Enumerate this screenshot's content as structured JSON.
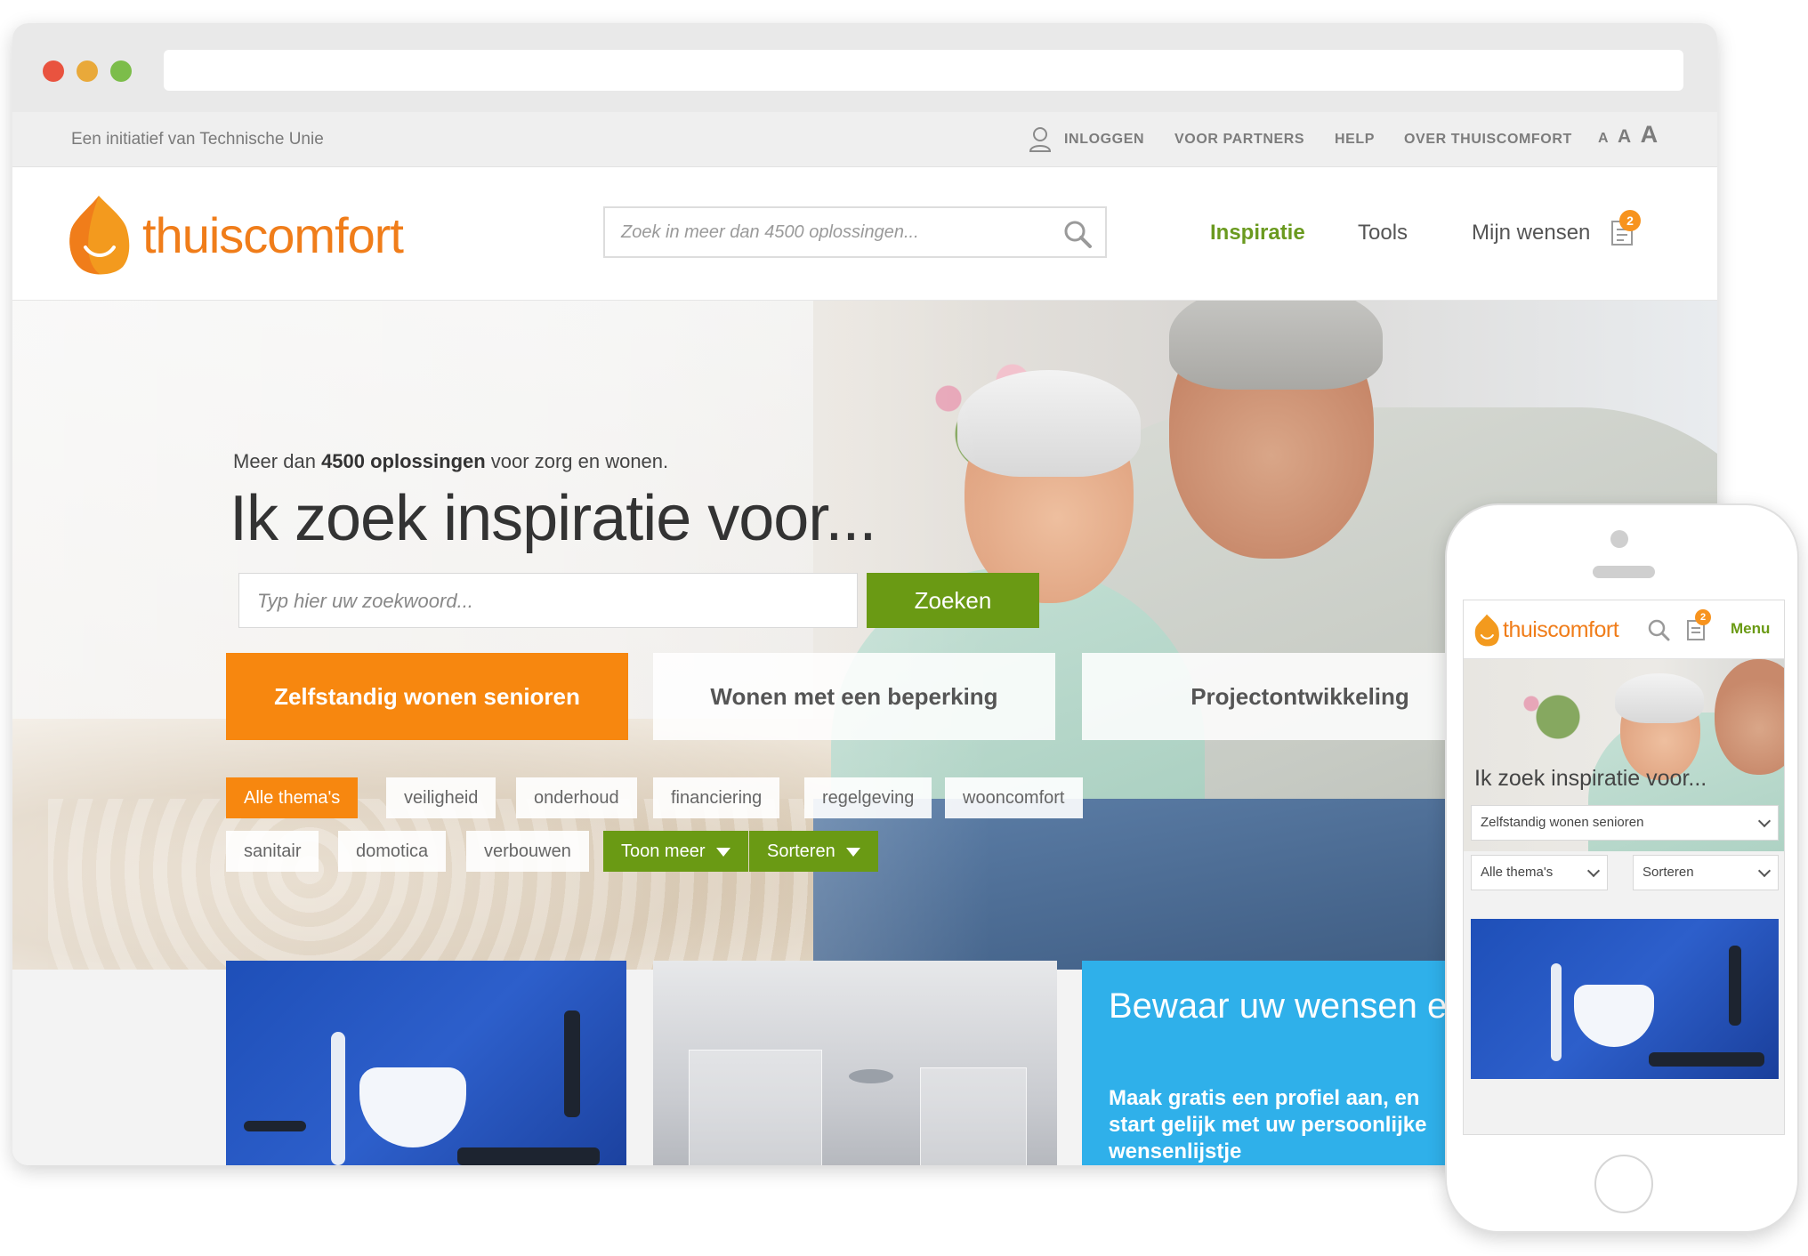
{
  "colors": {
    "brand_orange": "#f07d1a",
    "cta_green": "#6a9a14",
    "accent_orange": "#f7870f",
    "info_blue": "#2fb0ea"
  },
  "desktop": {
    "topbar": {
      "initiative": "Een initiatief van Technische Unie",
      "login": "INLOGGEN",
      "partners": "VOOR PARTNERS",
      "help": "HELP",
      "about": "OVER THUISCOMFORT",
      "font_small": "A",
      "font_medium": "A",
      "font_large": "A"
    },
    "header": {
      "logo": "thuiscomfort",
      "search_placeholder": "Zoek in meer dan 4500 oplossingen...",
      "nav": {
        "inspiratie": "Inspiratie",
        "tools": "Tools",
        "wensen": "Mijn wensen"
      },
      "wish_count": "2"
    },
    "hero": {
      "tagline_pre": "Meer dan ",
      "tagline_bold": "4500 oplossingen",
      "tagline_post": " voor zorg en wonen.",
      "headline": "Ik zoek inspiratie voor...",
      "search_placeholder": "Typ hier uw zoekwoord...",
      "search_button": "Zoeken",
      "categories": [
        "Zelfstandig wonen senioren",
        "Wonen met een beperking",
        "Projectontwikkeling"
      ],
      "tags_row1": [
        "Alle thema's",
        "veiligheid",
        "onderhoud",
        "financiering",
        "regelgeving",
        "wooncomfort"
      ],
      "tags_row2": [
        "sanitair",
        "domotica",
        "verbouwen"
      ],
      "toon_meer": "Toon meer",
      "sorteren": "Sorteren"
    },
    "promo": {
      "heading": "Bewaar uw wensen en adviezen",
      "body": "Maak gratis een profiel aan, en start gelijk met uw persoonlijke wensenlijstje"
    }
  },
  "mobile": {
    "logo": "thuiscomfort",
    "wish_count": "2",
    "menu": "Menu",
    "title": "Ik zoek inspiratie voor...",
    "select_category": "Zelfstandig wonen senioren",
    "select_theme": "Alle thema's",
    "select_sort": "Sorteren"
  }
}
